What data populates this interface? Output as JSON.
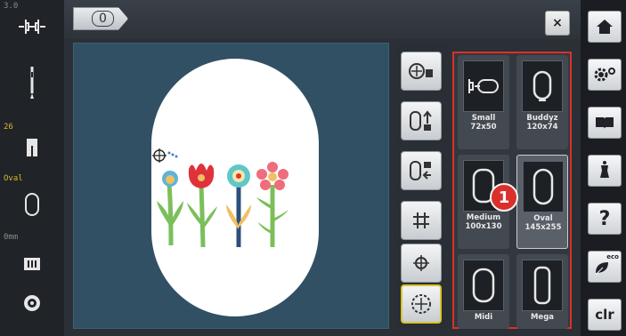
{
  "status": {
    "stitch_width": "3.0",
    "stitch_length": "26",
    "hoop_name": "Oval",
    "distance": "0mm"
  },
  "header": {
    "counter": "0",
    "close_label": "×"
  },
  "hoops": [
    {
      "name": "Small",
      "size": "72x50"
    },
    {
      "name": "Buddyz",
      "size": "120x74"
    },
    {
      "name": "Medium",
      "size": "100x130"
    },
    {
      "name": "Oval",
      "size": "145x255",
      "selected": true
    },
    {
      "name": "Midi",
      "size": ""
    },
    {
      "name": "Mega",
      "size": ""
    }
  ],
  "callout": "1",
  "function_bar": {
    "eco_label": "eco",
    "clr_label": "clr",
    "help_label": "?"
  },
  "colors": {
    "highlight": "#d9302b",
    "accent": "#d9c52b",
    "preview_bg": "#315064"
  }
}
